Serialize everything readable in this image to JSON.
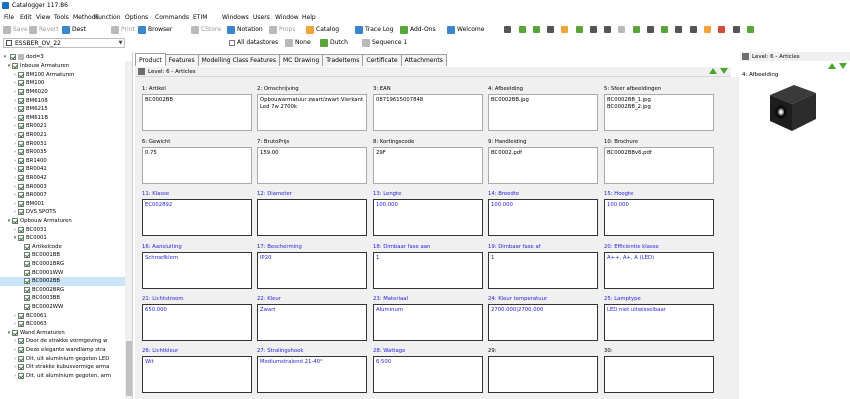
{
  "window": {
    "title": "Catalogger 117.86"
  },
  "menu": [
    "File",
    "Edit",
    "View",
    "Tools",
    "Methods",
    "Function",
    "Options",
    "Commands",
    "ETIM",
    "Windows",
    "Users",
    "Window",
    "Help"
  ],
  "toolbar": {
    "save": "Save",
    "revert": "Revert",
    "dest": "Dest",
    "print": "Print",
    "browser": "Browser",
    "cstore": "CStore",
    "notation": "Notation",
    "props": "Props",
    "catalog": "Catalog",
    "trace_log": "Trace Log",
    "add_ons": "Add-Ons",
    "welcome": "Welcome"
  },
  "toolbar2": {
    "datastore_value": "ESSBER_OV_22",
    "all_datastores": "All datastores",
    "none": "None",
    "dutch": "Dutch",
    "sequence": "Sequence 1"
  },
  "tree": {
    "header_value": "dod=3",
    "rows": [
      {
        "label": "Inbouw Armaturen",
        "indent": 2,
        "tw": "▾",
        "check": true,
        "folder": false
      },
      {
        "label": "BM100 Armaturen",
        "indent": 3,
        "tw": "›",
        "check": true,
        "folder": false
      },
      {
        "label": "BM100",
        "indent": 3,
        "tw": "›",
        "check": true,
        "folder": false
      },
      {
        "label": "BM6020",
        "indent": 3,
        "tw": "›",
        "check": true,
        "folder": false
      },
      {
        "label": "BM6108",
        "indent": 3,
        "tw": "›",
        "check": true,
        "folder": false
      },
      {
        "label": "BM6215",
        "indent": 3,
        "tw": "›",
        "check": true,
        "folder": false
      },
      {
        "label": "BM611B",
        "indent": 3,
        "tw": "›",
        "check": true,
        "folder": false
      },
      {
        "label": "BR0021",
        "indent": 3,
        "tw": "›",
        "check": true,
        "folder": false
      },
      {
        "label": "BR0021",
        "indent": 3,
        "tw": "›",
        "check": true,
        "folder": false
      },
      {
        "label": "BR0031",
        "indent": 3,
        "tw": "›",
        "check": true,
        "folder": false
      },
      {
        "label": "BR0035",
        "indent": 3,
        "tw": "›",
        "check": true,
        "folder": false
      },
      {
        "label": "BR1400",
        "indent": 3,
        "tw": "›",
        "check": true,
        "folder": false
      },
      {
        "label": "BR0041",
        "indent": 3,
        "tw": "›",
        "check": true,
        "folder": false
      },
      {
        "label": "BR0042",
        "indent": 3,
        "tw": "›",
        "check": true,
        "folder": false
      },
      {
        "label": "BR0003",
        "indent": 3,
        "tw": "›",
        "check": true,
        "folder": false
      },
      {
        "label": "BR0007",
        "indent": 3,
        "tw": "›",
        "check": true,
        "folder": false
      },
      {
        "label": "BM001",
        "indent": 3,
        "tw": "›",
        "check": true,
        "folder": false
      },
      {
        "label": "DVS SPOTS",
        "indent": 3,
        "tw": "›",
        "check": true,
        "folder": false
      },
      {
        "label": "Opbouw Armaturen",
        "indent": 2,
        "tw": "▾",
        "check": true,
        "folder": false
      },
      {
        "label": "BC0031",
        "indent": 3,
        "tw": "›",
        "check": true,
        "folder": false
      },
      {
        "label": "BC0001",
        "indent": 3,
        "tw": "▾",
        "check": true,
        "folder": false
      },
      {
        "label": "Artikelcode",
        "indent": 4,
        "tw": "",
        "check": true,
        "folder": false
      },
      {
        "label": "BC0001BB",
        "indent": 4,
        "tw": "",
        "check": true,
        "folder": false
      },
      {
        "label": "BC0001BRG",
        "indent": 4,
        "tw": "",
        "check": true,
        "folder": false
      },
      {
        "label": "BC0001WW",
        "indent": 4,
        "tw": "",
        "check": true,
        "folder": false
      },
      {
        "label": "BC0002BB",
        "indent": 4,
        "tw": "",
        "check": true,
        "folder": false,
        "selected": true
      },
      {
        "label": "BC0002BRG",
        "indent": 4,
        "tw": "",
        "check": true,
        "folder": false
      },
      {
        "label": "BC0003BB",
        "indent": 4,
        "tw": "",
        "check": true,
        "folder": false
      },
      {
        "label": "BC0002WW",
        "indent": 4,
        "tw": "",
        "check": true,
        "folder": false
      },
      {
        "label": "BC0061",
        "indent": 3,
        "tw": "›",
        "check": true,
        "folder": false
      },
      {
        "label": "BC0063",
        "indent": 3,
        "tw": "›",
        "check": true,
        "folder": false
      },
      {
        "label": "Wand Armaturen",
        "indent": 2,
        "tw": "▾",
        "check": true,
        "folder": false
      },
      {
        "label": "Door de strakke vormgeving w",
        "indent": 3,
        "tw": "›",
        "check": true,
        "folder": false
      },
      {
        "label": "Deze elegante wandlamp stra",
        "indent": 3,
        "tw": "›",
        "check": true,
        "folder": false
      },
      {
        "label": "Dit, uit aluminium gegoten LED",
        "indent": 3,
        "tw": "›",
        "check": true,
        "folder": false
      },
      {
        "label": "Dit strakke kubusvormige arma",
        "indent": 3,
        "tw": "›",
        "check": true,
        "folder": false
      },
      {
        "label": "Dit, uit aluminium gegoten, arm",
        "indent": 3,
        "tw": "›",
        "check": true,
        "folder": false
      }
    ]
  },
  "tabs": [
    "Product",
    "Features",
    "Modelling Class Features",
    "MC Drawing",
    "TradeItems",
    "Certificate",
    "Attachments"
  ],
  "level_label": "Level: 6 - Articles",
  "fields": [
    {
      "label": "1: Artikel",
      "value": "BC0002BB",
      "style": "normal"
    },
    {
      "label": "2: Omschrijving",
      "value": "Opbouwarmatuur zwart/zwart Vierkant Led 7w 2700k",
      "style": "normal"
    },
    {
      "label": "3: EAN",
      "value": "08719615007848",
      "style": "normal"
    },
    {
      "label": "4: Afbeelding",
      "value": "BC0002BB.jpg",
      "style": "normal"
    },
    {
      "label": "5: Sfeer afbeeldingen",
      "value": "BC0002BB_1.jpg\nBC0002BB_2.jpg",
      "style": "normal"
    },
    {
      "label": "6: Gewicht",
      "value": "0.75",
      "style": "normal"
    },
    {
      "label": "7: BrutoPrijs",
      "value": "159.00",
      "style": "normal"
    },
    {
      "label": "8: Kortingscode",
      "value": "29F",
      "style": "normal"
    },
    {
      "label": "9: Handleiding",
      "value": "BC0002.pdf",
      "style": "normal"
    },
    {
      "label": "10: Brochure",
      "value": "BC0002BBv6.pdf",
      "style": "normal"
    },
    {
      "label": "11: Klasse",
      "value": "EC002892",
      "style": "blue"
    },
    {
      "label": "12: Diameter",
      "value": "",
      "style": "blue"
    },
    {
      "label": "13: Lengte",
      "value": "100.000",
      "style": "blue"
    },
    {
      "label": "14: Breedte",
      "value": "100.000",
      "style": "blue"
    },
    {
      "label": "15: Hoogte",
      "value": "100.000",
      "style": "blue"
    },
    {
      "label": "16: Aansluiting",
      "value": "Schroefklem",
      "style": "blue"
    },
    {
      "label": "17: Bescherming",
      "value": "IP20",
      "style": "blue"
    },
    {
      "label": "18: Dimbaar fase aan",
      "value": "1",
      "style": "blue"
    },
    {
      "label": "19: Dimbaar fase af",
      "value": "1",
      "style": "blue"
    },
    {
      "label": "20: Efficientie klasse",
      "value": "A++, A+, A (LED)",
      "style": "blue"
    },
    {
      "label": "21: Lichtstroom",
      "value": "650.000",
      "style": "blue"
    },
    {
      "label": "22: Kleur",
      "value": "Zwart",
      "style": "blue"
    },
    {
      "label": "23: Materiaal",
      "value": "Aluminum",
      "style": "blue"
    },
    {
      "label": "24: Kleur temperatuur",
      "value": "2700.000|2700.000",
      "style": "blue"
    },
    {
      "label": "25: Lamptype",
      "value": "LED niet uitwisselbaar",
      "style": "blue"
    },
    {
      "label": "26: Lichtkleur",
      "value": "Wit",
      "style": "blue"
    },
    {
      "label": "27: Stralingshoek",
      "value": "Mediumstralend 21-40°",
      "style": "blue"
    },
    {
      "label": "28: Wattage",
      "value": "6.500",
      "style": "blue"
    },
    {
      "label": "29:",
      "value": "",
      "style": "normal"
    },
    {
      "label": "30:",
      "value": "",
      "style": "normal"
    }
  ],
  "right_panel": {
    "level_label": "Level: 6 - Articles",
    "image_label": "4: Afbeelding"
  },
  "colors": {
    "eti_label": "#1c1ce0",
    "nav_arrow": "#4aa62a",
    "selected_row": "#cce4f7"
  }
}
